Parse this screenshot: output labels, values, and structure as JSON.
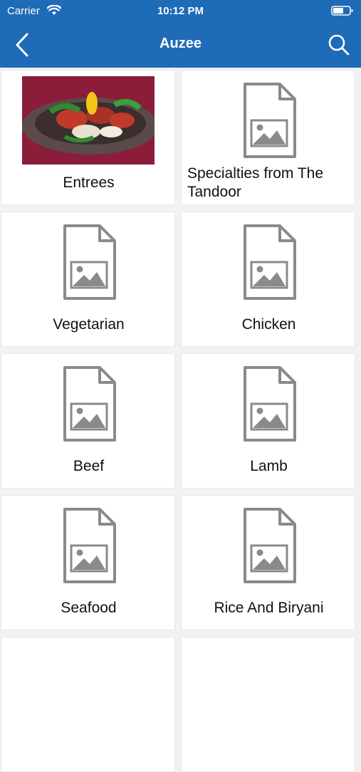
{
  "status_bar": {
    "carrier": "Carrier",
    "time": "10:12 PM"
  },
  "navbar": {
    "title": "Auzee"
  },
  "categories": [
    {
      "label": "Entrees",
      "icon": "photo-thumbnail"
    },
    {
      "label": "Specialties from The Tandoor",
      "icon": "image-placeholder-icon"
    },
    {
      "label": "Vegetarian",
      "icon": "image-placeholder-icon"
    },
    {
      "label": "Chicken",
      "icon": "image-placeholder-icon"
    },
    {
      "label": "Beef",
      "icon": "image-placeholder-icon"
    },
    {
      "label": "Lamb",
      "icon": "image-placeholder-icon"
    },
    {
      "label": "Seafood",
      "icon": "image-placeholder-icon"
    },
    {
      "label": "Rice And Biryani",
      "icon": "image-placeholder-icon"
    }
  ],
  "colors": {
    "header": "#1e6bb8",
    "tile_bg": "#ffffff",
    "page_bg": "#f2f2f2"
  }
}
